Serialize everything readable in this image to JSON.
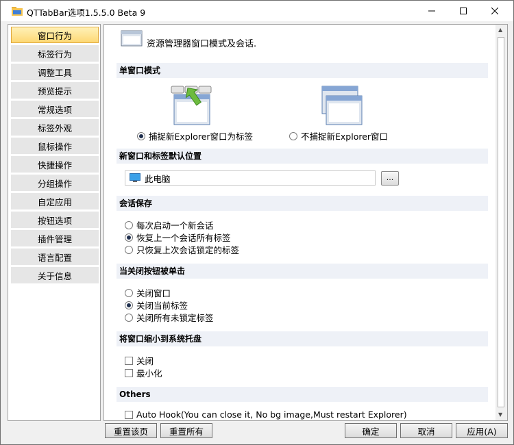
{
  "window": {
    "title": "QTTabBar选项1.5.5.0 Beta 9"
  },
  "sidebar": {
    "items": [
      {
        "label": "窗口行为",
        "active": true
      },
      {
        "label": "标签行为"
      },
      {
        "label": "调整工具"
      },
      {
        "label": "预览提示"
      },
      {
        "label": "常规选项"
      },
      {
        "label": "标签外观"
      },
      {
        "label": "鼠标操作"
      },
      {
        "label": "快捷操作"
      },
      {
        "label": "分组操作"
      },
      {
        "label": "自定应用"
      },
      {
        "label": "按钮选项"
      },
      {
        "label": "插件管理"
      },
      {
        "label": "语言配置"
      },
      {
        "label": "关于信息"
      }
    ]
  },
  "header": {
    "description": "资源管理器窗口模式及会话."
  },
  "sections": {
    "single_window": {
      "title": "单窗口模式",
      "option_capture": "捕捉新Explorer窗口为标签",
      "option_no_capture": "不捕捉新Explorer窗口",
      "selected": "capture"
    },
    "default_location": {
      "title": "新窗口和标签默认位置",
      "path": "此电脑",
      "browse_label": "..."
    },
    "session": {
      "title": "会话保存",
      "options": [
        "每次启动一个新会话",
        "恢复上一个会话所有标签",
        "只恢复上次会话锁定的标签"
      ],
      "selected_index": 1
    },
    "close_button": {
      "title": "当关闭按钮被单击",
      "options": [
        "关闭窗口",
        "关闭当前标签",
        "关闭所有未锁定标签"
      ],
      "selected_index": 1
    },
    "tray": {
      "title": "将窗口缩小到系统托盘",
      "options": [
        "关闭",
        "最小化"
      ]
    },
    "others": {
      "title": "Others",
      "auto_hook": "Auto Hook(You can close it, No bg image,Must restart Explorer)"
    }
  },
  "footer": {
    "reset_page": "重置该页",
    "reset_all": "重置所有",
    "ok": "确定",
    "cancel": "取消",
    "apply": "应用(A)"
  }
}
